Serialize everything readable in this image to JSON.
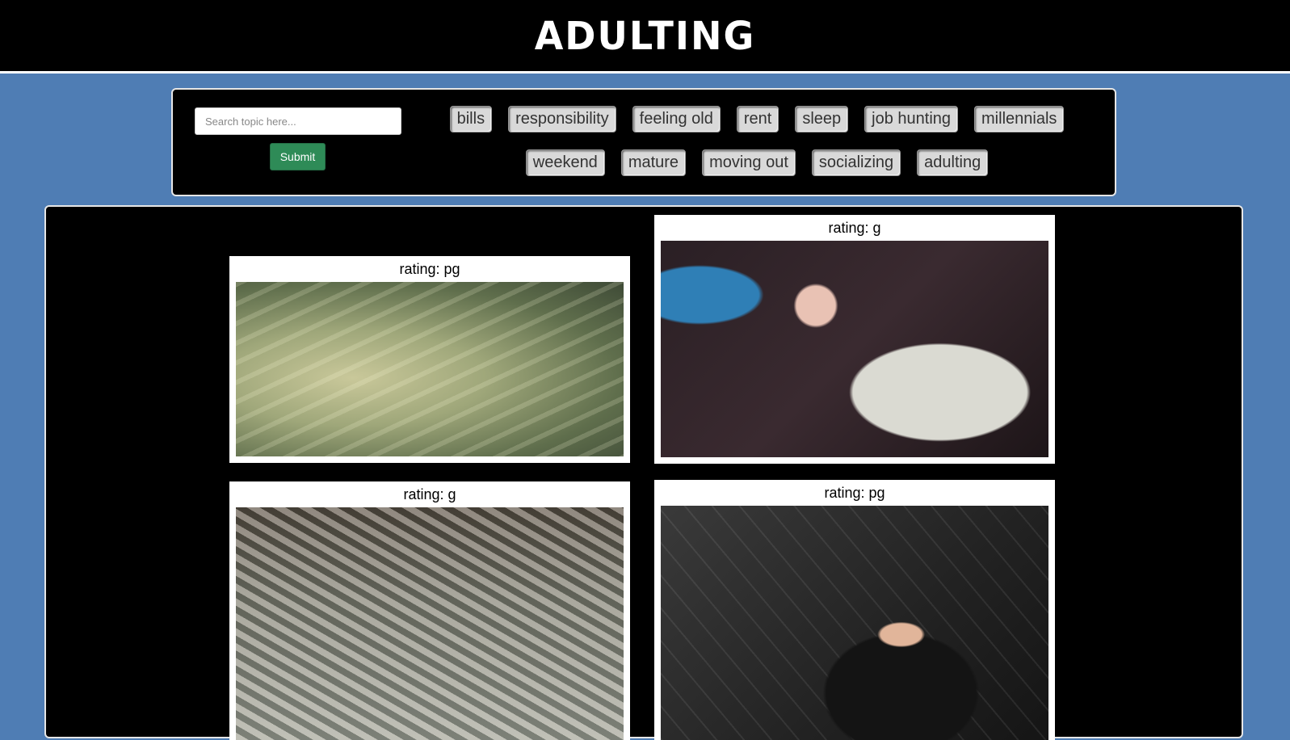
{
  "header": {
    "title": "ADULTING"
  },
  "search": {
    "placeholder": "Search topic here...",
    "value": "",
    "submit_label": "Submit"
  },
  "topics": {
    "row1": [
      "bills",
      "responsibility",
      "feeling old",
      "rent",
      "sleep",
      "job hunting",
      "millennials"
    ],
    "row2": [
      "weekend",
      "mature",
      "moving out",
      "socializing",
      "adulting"
    ]
  },
  "results": [
    {
      "rating": "rating: pg",
      "image": "dollar bills closeup"
    },
    {
      "rating": "rating: g",
      "image": "woman lying in money"
    },
    {
      "rating": "rating: g",
      "image": "hands counting cash stacks"
    },
    {
      "rating": "rating: pg",
      "image": "man throwing money"
    }
  ],
  "colors": {
    "page_background": "#4f7db4",
    "panel_background": "#000000",
    "submit_button": "#2e8b57",
    "topic_button": "#d9d9d9"
  }
}
